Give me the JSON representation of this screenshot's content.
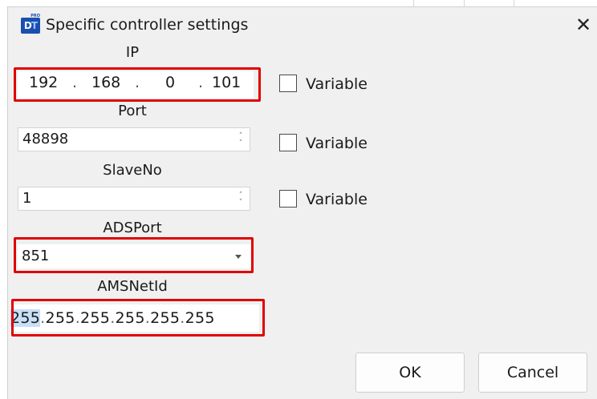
{
  "window": {
    "title": "Specific controller settings"
  },
  "fields": {
    "ip": {
      "label": "IP",
      "octets": [
        "192",
        "168",
        "0",
        "101"
      ],
      "separator": "."
    },
    "port": {
      "label": "Port",
      "value": "48898"
    },
    "slave": {
      "label": "SlaveNo",
      "value": "1"
    },
    "adsport": {
      "label": "ADSPort",
      "value": "851"
    },
    "amsnetid": {
      "label": "AMSNetId",
      "segments": [
        "255",
        "255",
        "255",
        "255",
        "255",
        "255"
      ],
      "separator": "."
    }
  },
  "checkboxes": {
    "ip_variable": {
      "label": "Variable",
      "checked": false
    },
    "port_variable": {
      "label": "Variable",
      "checked": false
    },
    "slave_variable": {
      "label": "Variable",
      "checked": false
    }
  },
  "buttons": {
    "ok": "OK",
    "cancel": "Cancel"
  },
  "colors": {
    "highlight": "#e00000",
    "icon": "#1a4fb0",
    "selection": "#c7dff7"
  }
}
